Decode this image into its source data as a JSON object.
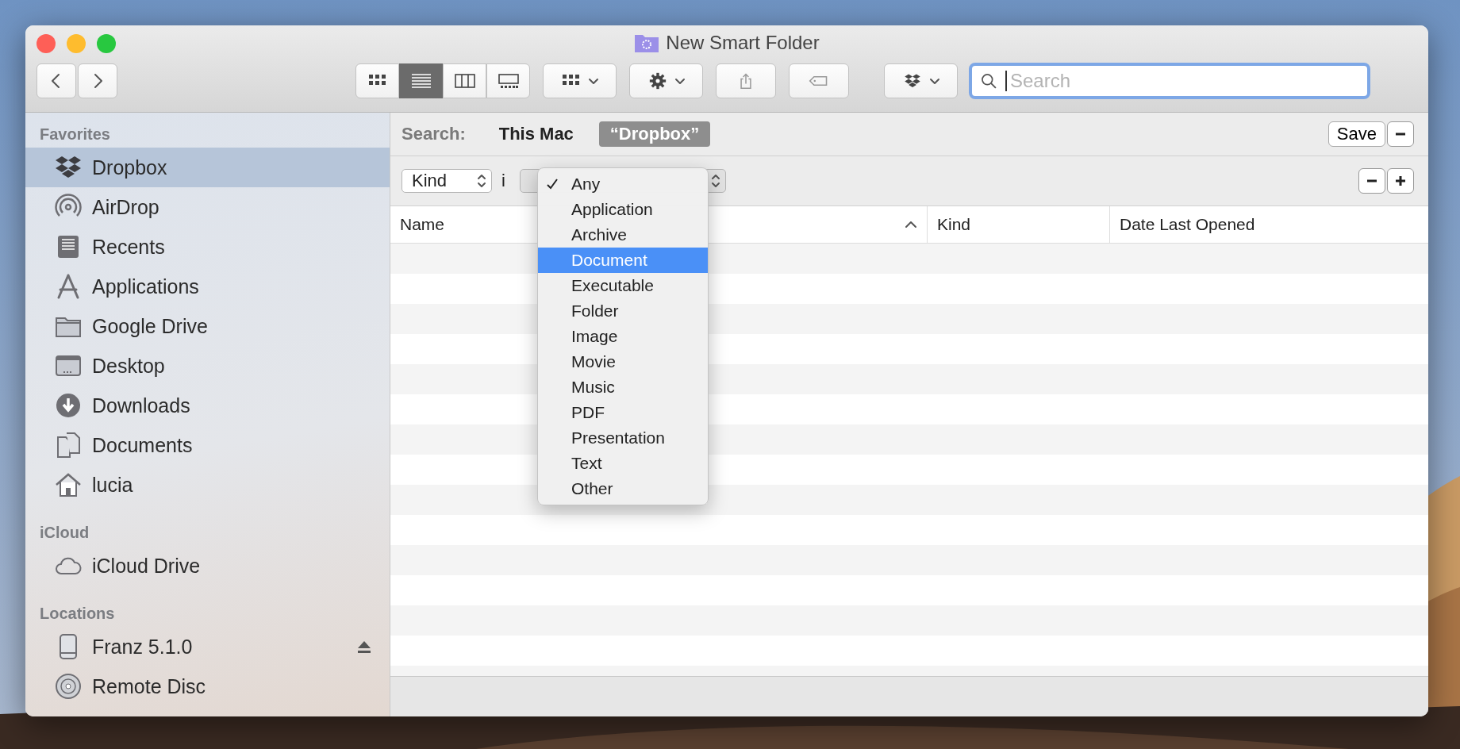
{
  "window": {
    "title": "New Smart Folder"
  },
  "toolbar": {
    "view_modes": [
      {
        "kind": "icons",
        "selected": false
      },
      {
        "kind": "list",
        "selected": true
      },
      {
        "kind": "columns",
        "selected": false
      },
      {
        "kind": "gallery",
        "selected": false
      }
    ],
    "search": {
      "placeholder": "Search"
    }
  },
  "sidebar": {
    "sections": [
      {
        "title": "Favorites",
        "items": [
          {
            "label": "Dropbox",
            "kind": "dropbox",
            "selected": true
          },
          {
            "label": "AirDrop",
            "kind": "airdrop",
            "selected": false
          },
          {
            "label": "Recents",
            "kind": "recents",
            "selected": false
          },
          {
            "label": "Applications",
            "kind": "applications",
            "selected": false
          },
          {
            "label": "Google Drive",
            "kind": "folder",
            "selected": false
          },
          {
            "label": "Desktop",
            "kind": "desktop",
            "selected": false
          },
          {
            "label": "Downloads",
            "kind": "downloads",
            "selected": false
          },
          {
            "label": "Documents",
            "kind": "documents",
            "selected": false
          },
          {
            "label": "lucia",
            "kind": "home",
            "selected": false
          }
        ]
      },
      {
        "title": "iCloud",
        "items": [
          {
            "label": "iCloud Drive",
            "kind": "cloud",
            "selected": false
          }
        ]
      },
      {
        "title": "Locations",
        "items": [
          {
            "label": "Franz 5.1.0",
            "kind": "drive",
            "selected": false
          },
          {
            "label": "Remote Disc",
            "kind": "disc",
            "selected": false
          }
        ]
      }
    ]
  },
  "search_bar": {
    "label": "Search:",
    "scopes": [
      {
        "label": "This Mac",
        "selected": false
      },
      {
        "label": "“Dropbox”",
        "selected": true
      }
    ],
    "save": "Save"
  },
  "criteria": {
    "attribute": "Kind",
    "operator": "i"
  },
  "kind_menu": {
    "items": [
      {
        "label": "Any",
        "checked": true,
        "selected": false
      },
      {
        "label": "Application",
        "checked": false,
        "selected": false
      },
      {
        "label": "Archive",
        "checked": false,
        "selected": false
      },
      {
        "label": "Document",
        "checked": false,
        "selected": true
      },
      {
        "label": "Executable",
        "checked": false,
        "selected": false
      },
      {
        "label": "Folder",
        "checked": false,
        "selected": false
      },
      {
        "label": "Image",
        "checked": false,
        "selected": false
      },
      {
        "label": "Movie",
        "checked": false,
        "selected": false
      },
      {
        "label": "Music",
        "checked": false,
        "selected": false
      },
      {
        "label": "PDF",
        "checked": false,
        "selected": false
      },
      {
        "label": "Presentation",
        "checked": false,
        "selected": false
      },
      {
        "label": "Text",
        "checked": false,
        "selected": false
      },
      {
        "label": "Other",
        "checked": false,
        "selected": false
      }
    ]
  },
  "table": {
    "columns": [
      {
        "label": "Name",
        "sorted": true
      },
      {
        "label": "Kind",
        "sorted": false
      },
      {
        "label": "Date Last Opened",
        "sorted": false
      }
    ]
  }
}
